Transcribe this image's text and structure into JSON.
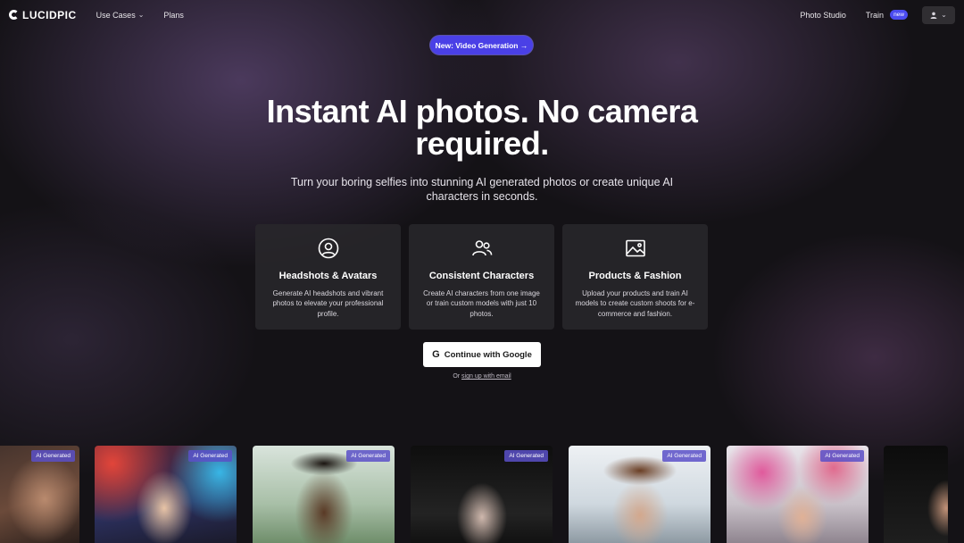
{
  "brand": {
    "name": "LUCIDPIC"
  },
  "nav": {
    "use_cases": "Use Cases",
    "plans": "Plans",
    "photo_studio": "Photo Studio",
    "train": "Train",
    "train_badge": "new"
  },
  "announcement": {
    "label": "New: Video Generation →"
  },
  "hero": {
    "title_line1": "Instant AI photos. No camera",
    "title_line2": "required.",
    "subtitle": "Turn your boring selfies into stunning AI generated photos or create unique AI characters in seconds."
  },
  "features": [
    {
      "icon": "user-circle-icon",
      "title": "Headshots & Avatars",
      "desc": "Generate AI headshots and vibrant photos to elevate your professional profile."
    },
    {
      "icon": "users-icon",
      "title": "Consistent Characters",
      "desc": "Create AI characters from one image or train custom models with just 10 photos."
    },
    {
      "icon": "image-icon",
      "title": "Products & Fashion",
      "desc": "Upload your products and train AI models to create custom shoots for e-commerce and fashion."
    }
  ],
  "cta": {
    "google_icon": "G",
    "google_label": "Continue with Google",
    "alt_prefix": "Or",
    "alt_link": "sign up with email"
  },
  "gallery": {
    "tag": "AI Generated",
    "tags": [
      "AI Generated",
      "AI Generated",
      "AI Generated",
      "AI Generated",
      "AI Generated",
      "AI Generated"
    ]
  },
  "colors": {
    "accent": "#4a40e6",
    "background": "#141216"
  }
}
